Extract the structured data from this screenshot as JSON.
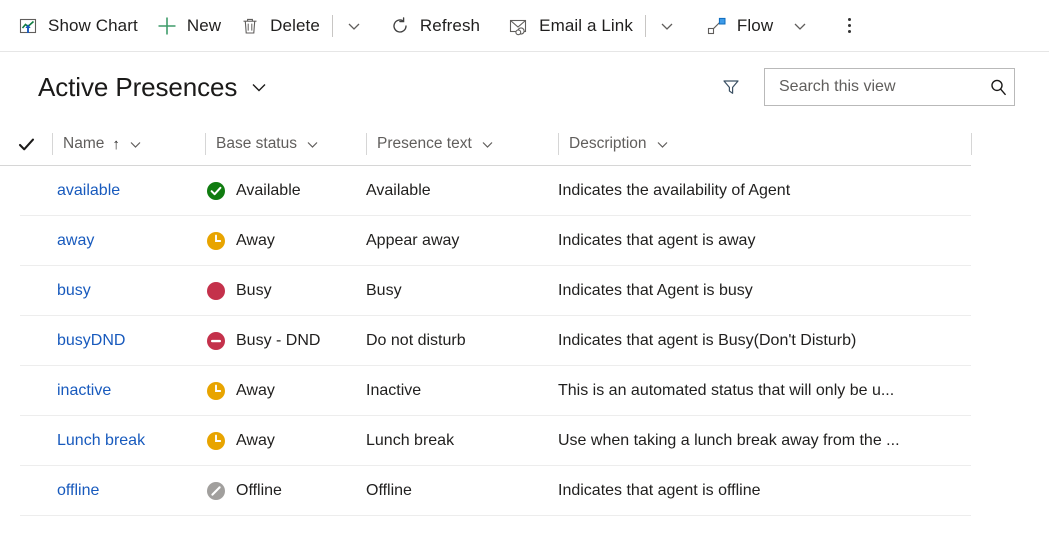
{
  "command_bar": {
    "items": [
      {
        "id": "show-chart",
        "label": "Show Chart",
        "icon": "show-chart-icon"
      },
      {
        "id": "new",
        "label": "New",
        "icon": "plus-icon"
      },
      {
        "id": "delete",
        "label": "Delete",
        "icon": "trash-icon"
      },
      {
        "id": "refresh",
        "label": "Refresh",
        "icon": "refresh-icon"
      },
      {
        "id": "email-a-link",
        "label": "Email a Link",
        "icon": "email-link-icon"
      },
      {
        "id": "flow",
        "label": "Flow",
        "icon": "flow-icon"
      }
    ],
    "overflow_label": "More commands"
  },
  "view": {
    "title": "Active Presences",
    "chevron_icon": "chevron-down-icon"
  },
  "search": {
    "placeholder": "Search this view",
    "value": "",
    "icon": "search-icon",
    "filter_icon": "filter-icon"
  },
  "grid": {
    "select_all_icon": "checkmark-icon",
    "columns": [
      {
        "key": "name",
        "label": "Name",
        "sorted": true,
        "sort_icon": "arrow-up-icon"
      },
      {
        "key": "base_status",
        "label": "Base status",
        "sorted": false
      },
      {
        "key": "presence_text",
        "label": "Presence text",
        "sorted": false
      },
      {
        "key": "description",
        "label": "Description",
        "sorted": false
      }
    ],
    "rows": [
      {
        "name": "available",
        "base_status": "Available",
        "status_icon": "available-icon",
        "presence_text": "Available",
        "description": "Indicates the availability of Agent"
      },
      {
        "name": "away",
        "base_status": "Away",
        "status_icon": "away-icon",
        "presence_text": "Appear away",
        "description": "Indicates that agent is away"
      },
      {
        "name": "busy",
        "base_status": "Busy",
        "status_icon": "busy-icon",
        "presence_text": "Busy",
        "description": "Indicates that Agent is busy"
      },
      {
        "name": "busyDND",
        "base_status": "Busy - DND",
        "status_icon": "dnd-icon",
        "presence_text": "Do not disturb",
        "description": "Indicates that agent is Busy(Don't Disturb)"
      },
      {
        "name": "inactive",
        "base_status": "Away",
        "status_icon": "away-icon",
        "presence_text": "Inactive",
        "description": "This is an automated status that will only be u..."
      },
      {
        "name": "Lunch break",
        "base_status": "Away",
        "status_icon": "away-icon",
        "presence_text": "Lunch break",
        "description": "Use when taking a lunch break away from the ..."
      },
      {
        "name": "offline",
        "base_status": "Offline",
        "status_icon": "offline-icon",
        "presence_text": "Offline",
        "description": "Indicates that agent is offline"
      }
    ]
  },
  "colors": {
    "link": "#185abd",
    "available_green": "#107c10",
    "away_orange": "#e8a400",
    "busy_red": "#c4314b",
    "offline_gray": "#a19f9d",
    "header_text": "#605e5c",
    "flow_blue": "#0078d4",
    "chart_green": "#107c41"
  }
}
